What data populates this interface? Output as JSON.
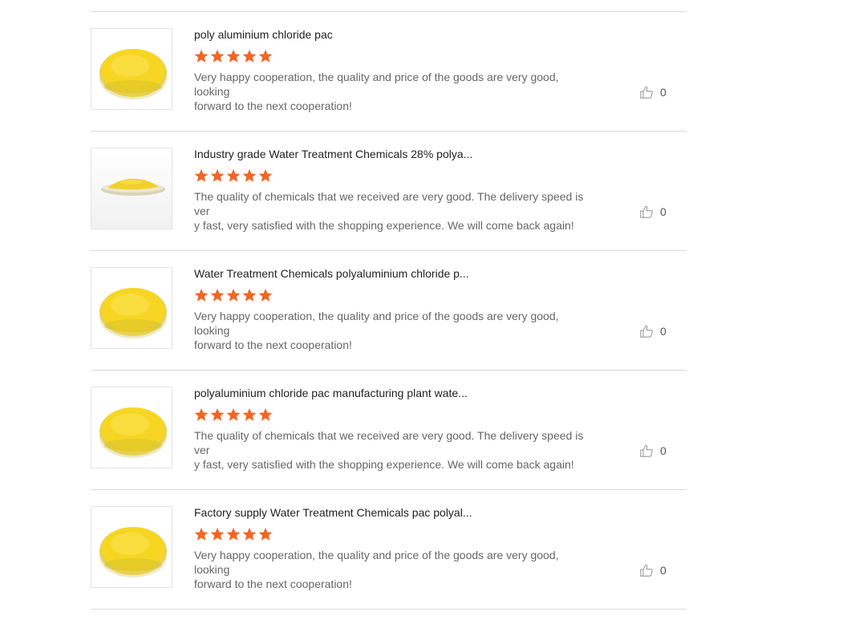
{
  "reviews": [
    {
      "title": "poly aluminium chloride pac",
      "rating": 5,
      "comment": "Very happy cooperation, the quality and price of the goods are very good, looking\nforward to the next cooperation!",
      "likes": "0",
      "image": "yellow-powder-dish"
    },
    {
      "title": "Industry grade Water Treatment Chemicals 28% polya...",
      "rating": 5,
      "comment": "The quality of chemicals that we received are very good. The delivery speed is ver\ny fast,  very satisfied with the shopping experience. We will come back again!",
      "likes": "0",
      "image": "yellow-powder-flat-dish"
    },
    {
      "title": "Water Treatment Chemicals polyaluminium chloride p...",
      "rating": 5,
      "comment": "Very happy cooperation, the quality and price of the goods are very good, looking\nforward to the next cooperation!",
      "likes": "0",
      "image": "yellow-powder-dish"
    },
    {
      "title": "polyaluminium chloride pac manufacturing plant wate...",
      "rating": 5,
      "comment": "The quality of chemicals that we received are very good. The delivery speed is ver\ny fast,  very satisfied with the shopping experience. We will come back again!",
      "likes": "0",
      "image": "yellow-powder-dish"
    },
    {
      "title": "Factory supply Water Treatment Chemicals pac polyal...",
      "rating": 5,
      "comment": "Very happy cooperation, the quality and price of the goods are very good, looking\nforward to the next cooperation!",
      "likes": "0",
      "image": "yellow-powder-dish"
    }
  ],
  "colors": {
    "star": "#f26522",
    "title": "#222222",
    "comment": "#666666",
    "divider": "#d9d9d9",
    "powder": "#f5d020"
  }
}
